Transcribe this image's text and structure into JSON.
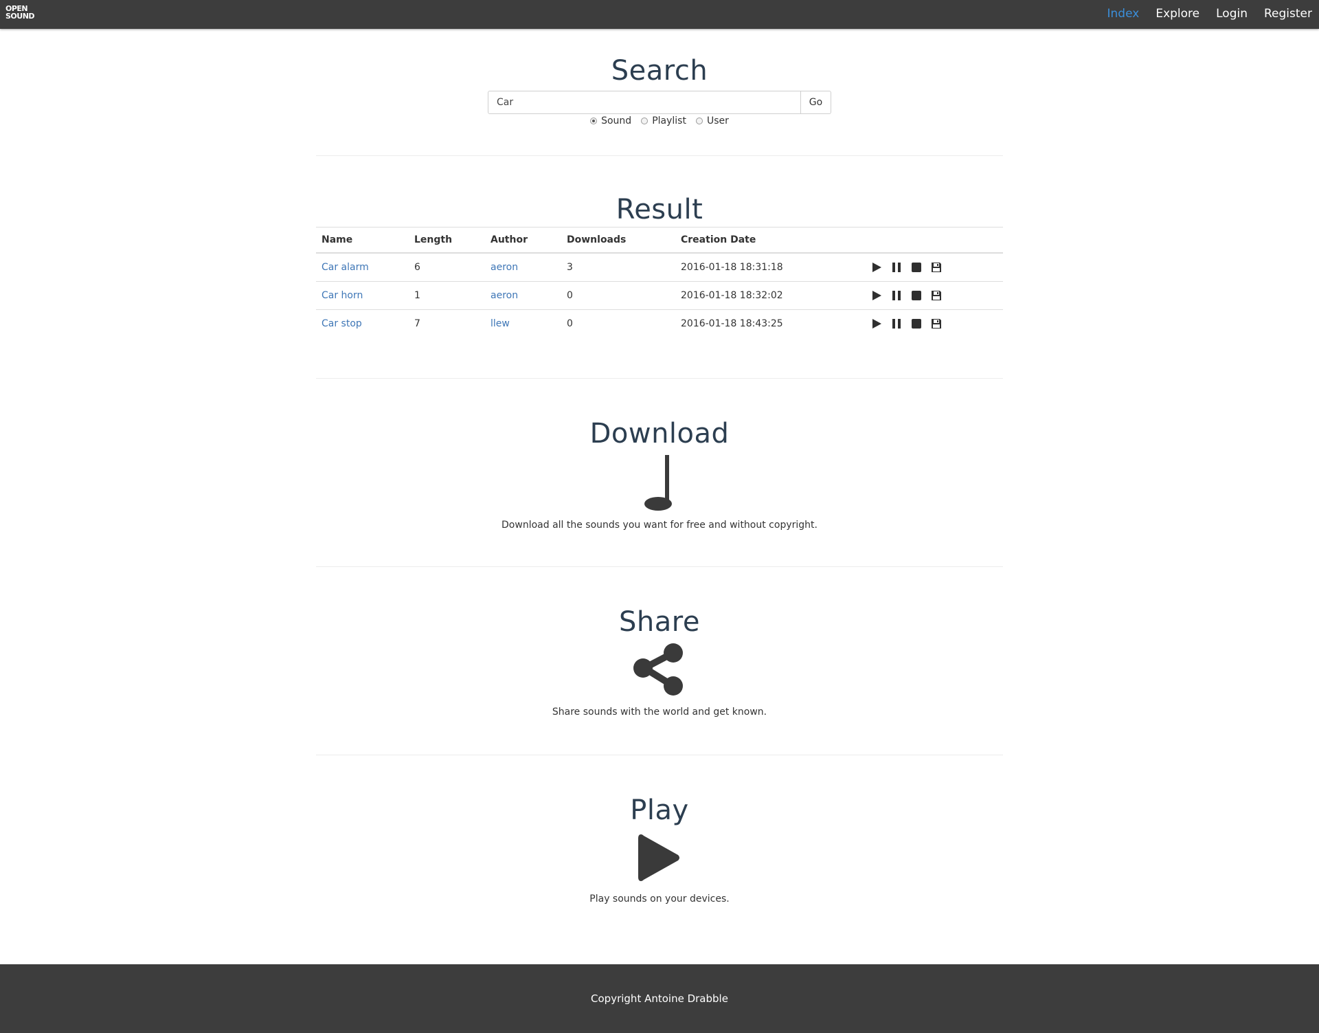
{
  "nav": {
    "logo_line1": "OPEN",
    "logo_line2": "SOUND",
    "links": [
      "Index",
      "Explore",
      "Login",
      "Register"
    ],
    "active_color": "#3b8fdb"
  },
  "search": {
    "title": "Search",
    "query": "Car",
    "go_label": "Go",
    "options": [
      "Sound",
      "Playlist",
      "User"
    ],
    "selected": "Sound"
  },
  "result": {
    "title": "Result",
    "headers": [
      "Name",
      "Length",
      "Author",
      "Downloads",
      "Creation Date"
    ],
    "rows": [
      {
        "name": "Car alarm",
        "length": "6",
        "author": "aeron",
        "downloads": "3",
        "date": "2016-01-18 18:31:18"
      },
      {
        "name": "Car horn",
        "length": "1",
        "author": "aeron",
        "downloads": "0",
        "date": "2016-01-18 18:32:02"
      },
      {
        "name": "Car stop",
        "length": "7",
        "author": "llew",
        "downloads": "0",
        "date": "2016-01-18 18:43:25"
      }
    ],
    "row_actions": [
      "play-icon",
      "pause-icon",
      "stop-icon",
      "save-icon"
    ]
  },
  "features": {
    "download": {
      "title": "Download",
      "text": "Download all the sounds you want for free and without copyright.",
      "icon": "music-note-icon"
    },
    "share": {
      "title": "Share",
      "text": "Share sounds with the world and get known.",
      "icon": "share-icon"
    },
    "play": {
      "title": "Play",
      "text": "Play sounds on your devices.",
      "icon": "play-icon"
    }
  },
  "footer": {
    "text": "Copyright Antoine Drabble"
  },
  "colors": {
    "navbar": "#3d3d3d",
    "link": "#3e76b6",
    "heading": "#2c3e50"
  }
}
